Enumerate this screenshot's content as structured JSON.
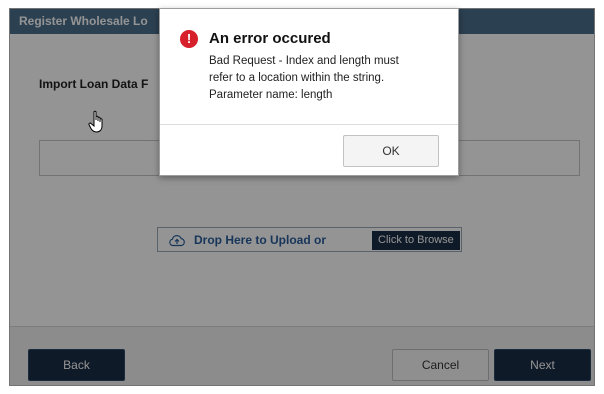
{
  "window": {
    "title": "Register Wholesale Lo"
  },
  "main": {
    "section_title": "Import Loan Data F",
    "drop_zone": {
      "label": "Drop Here to Upload or",
      "browse_label": "Click to Browse",
      "icon": "cloud-upload-icon"
    }
  },
  "footer": {
    "back_label": "Back",
    "cancel_label": "Cancel",
    "next_label": "Next"
  },
  "modal": {
    "icon": "error-icon",
    "icon_glyph": "!",
    "title": "An error occured",
    "message_lines": [
      "Bad Request - Index and length must",
      "refer to a location within the string.",
      "Parameter name: length"
    ],
    "ok_label": "OK"
  },
  "colors": {
    "primary_button": "#1b2d45",
    "error": "#d6202b",
    "link": "#2a5d9c"
  }
}
